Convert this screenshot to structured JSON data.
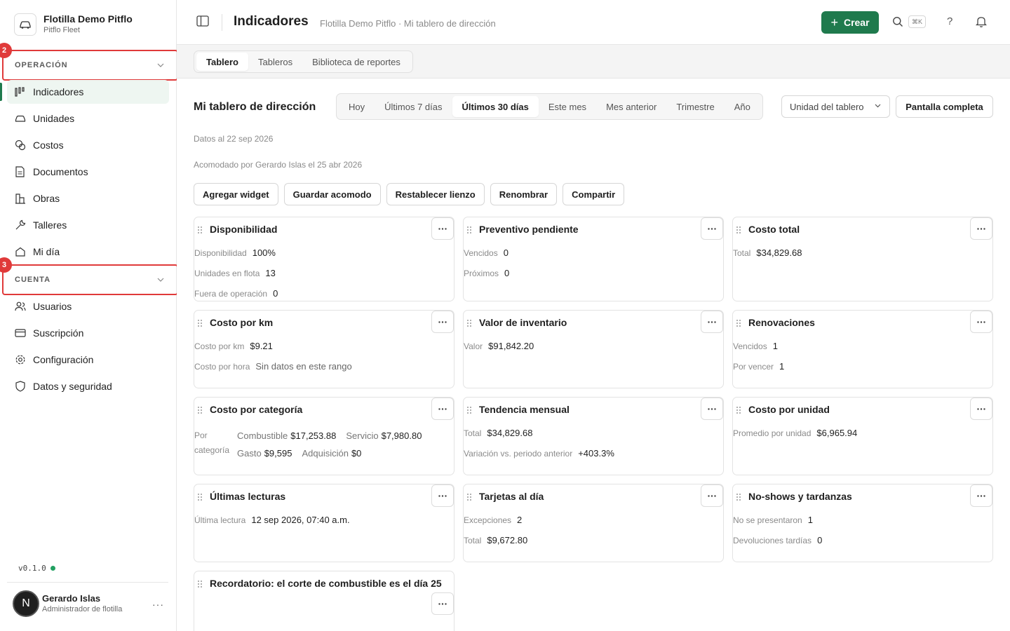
{
  "brand": {
    "name": "Flotilla Demo Pitflo",
    "sub": "Pitflo Fleet"
  },
  "sidebar": {
    "section_operacion": {
      "label": "OPERACIÓN",
      "badge": "2"
    },
    "section_cuenta": {
      "label": "CUENTA",
      "badge": "3"
    },
    "operacion_items": [
      {
        "label": "Indicadores",
        "icon": "chart-bars-icon",
        "active": true
      },
      {
        "label": "Unidades",
        "icon": "car-icon"
      },
      {
        "label": "Costos",
        "icon": "coins-icon"
      },
      {
        "label": "Documentos",
        "icon": "document-icon"
      },
      {
        "label": "Obras",
        "icon": "building-icon"
      },
      {
        "label": "Talleres",
        "icon": "wrench-icon"
      },
      {
        "label": "Mi día",
        "icon": "house-icon"
      }
    ],
    "cuenta_items": [
      {
        "label": "Usuarios",
        "icon": "users-icon"
      },
      {
        "label": "Suscripción",
        "icon": "card-icon"
      },
      {
        "label": "Configuración",
        "icon": "gear-icon"
      },
      {
        "label": "Datos y seguridad",
        "icon": "shield-icon"
      }
    ],
    "version": "v0.1.0",
    "user": {
      "initial": "N",
      "name": "Gerardo Islas",
      "role": "Administrador de flotilla",
      "more": "···"
    }
  },
  "topbar": {
    "title": "Indicadores",
    "breadcrumb": "Flotilla Demo Pitflo · Mi tablero de dirección",
    "create_label": "Crear",
    "kbd": "⌘K",
    "help": "?"
  },
  "tabs": [
    "Tablero",
    "Tableros",
    "Biblioteca de reportes"
  ],
  "dashboard": {
    "title": "Mi tablero de dirección",
    "ranges": [
      "Hoy",
      "Últimos 7 días",
      "Últimos 30 días",
      "Este mes",
      "Mes anterior",
      "Trimestre",
      "Año"
    ],
    "active_range": "Últimos 30 días",
    "unit_select": "Unidad del tablero",
    "fullscreen": "Pantalla completa",
    "data_as_of": "Datos al 22 sep 2026",
    "arranged_by": "Acomodado por Gerardo Islas el 25 abr 2026",
    "actions": [
      "Agregar widget",
      "Guardar acomodo",
      "Restablecer lienzo",
      "Renombrar",
      "Compartir"
    ]
  },
  "widgets": {
    "disponibilidad": {
      "title": "Disponibilidad",
      "rows": [
        {
          "k": "Disponibilidad",
          "v": "100%"
        },
        {
          "k": "Unidades en flota",
          "v": "13"
        },
        {
          "k": "Fuera de operación",
          "v": "0"
        }
      ]
    },
    "preventivo": {
      "title": "Preventivo pendiente",
      "rows": [
        {
          "k": "Vencidos",
          "v": "0"
        },
        {
          "k": "Próximos",
          "v": "0"
        }
      ]
    },
    "costo_total": {
      "title": "Costo total",
      "rows": [
        {
          "k": "Total",
          "v": "$34,829.68"
        }
      ]
    },
    "costo_km": {
      "title": "Costo por km",
      "rows": [
        {
          "k": "Costo por km",
          "v": "$9.21"
        },
        {
          "k": "Costo por hora",
          "v": "Sin datos en este rango"
        }
      ]
    },
    "inventario": {
      "title": "Valor de inventario",
      "rows": [
        {
          "k": "Valor",
          "v": "$91,842.20"
        }
      ]
    },
    "renovaciones": {
      "title": "Renovaciones",
      "rows": [
        {
          "k": "Vencidos",
          "v": "1"
        },
        {
          "k": "Por vencer",
          "v": "1"
        }
      ]
    },
    "costo_categoria": {
      "title": "Costo por categoría",
      "label_a": "Por",
      "label_b": "categoría",
      "items": [
        {
          "k": "Combustible",
          "v": "$17,253.88"
        },
        {
          "k": "Servicio",
          "v": "$7,980.80"
        },
        {
          "k": "Gasto",
          "v": "$9,595"
        },
        {
          "k": "Adquisición",
          "v": "$0"
        }
      ]
    },
    "tendencia": {
      "title": "Tendencia mensual",
      "rows": [
        {
          "k": "Total",
          "v": "$34,829.68"
        },
        {
          "k": "Variación vs. periodo anterior",
          "v": "+403.3%"
        }
      ]
    },
    "costo_unidad": {
      "title": "Costo por unidad",
      "rows": [
        {
          "k": "Promedio por unidad",
          "v": "$6,965.94"
        }
      ]
    },
    "lecturas": {
      "title": "Últimas lecturas",
      "rows": [
        {
          "k": "Última lectura",
          "v": "12 sep 2026, 07:40 a.m."
        }
      ]
    },
    "tarjetas": {
      "title": "Tarjetas al día",
      "rows": [
        {
          "k": "Excepciones",
          "v": "2"
        },
        {
          "k": "Total",
          "v": "$9,672.80"
        }
      ]
    },
    "noshows": {
      "title": "No-shows y tardanzas",
      "rows": [
        {
          "k": "No se presentaron",
          "v": "1"
        },
        {
          "k": "Devoluciones tardías",
          "v": "0"
        }
      ]
    },
    "recordatorio": {
      "title": "Recordatorio: el corte de combustible es el día 25"
    }
  }
}
